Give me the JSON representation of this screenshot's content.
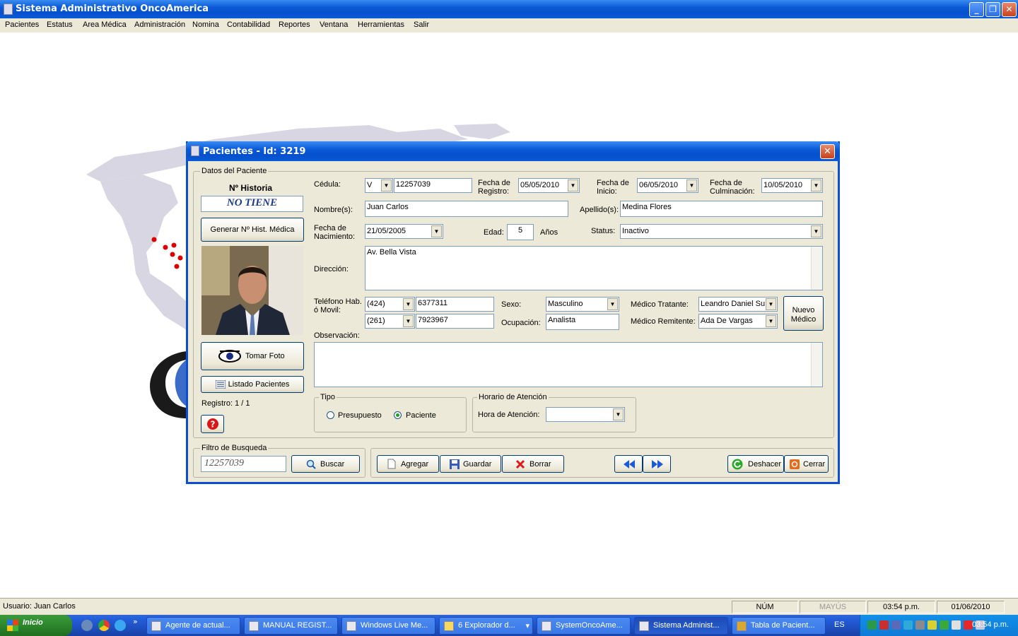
{
  "app": {
    "title": "Sistema Administrativo OncoAmerica"
  },
  "menu": [
    "Pacientes",
    "Estatus",
    "Area Médica",
    "Administración",
    "Nomina",
    "Contabilidad",
    "Reportes",
    "Ventana",
    "Herramientas",
    "Salir"
  ],
  "dialog": {
    "title": "Pacientes - Id: 3219",
    "group_datos": "Datos del Paciente",
    "historia_label": "Nº Historia",
    "historia_value": "NO TIENE",
    "gen_hist_button": "Generar Nº Hist. Médica",
    "tomar_foto_button": "Tomar Foto",
    "listado_button": "Listado Pacientes",
    "registro": "Registro:  1 / 1",
    "cedula_label": "Cédula:",
    "cedula_tipo": "V",
    "cedula_value": "12257039",
    "fecha_registro_label": "Fecha de Registro:",
    "fecha_registro": "05/05/2010",
    "fecha_inicio_label": "Fecha de Inicio:",
    "fecha_inicio": "06/05/2010",
    "fecha_culm_label": "Fecha de Culminación:",
    "fecha_culm": "10/05/2010",
    "nombres_label": "Nombre(s):",
    "nombres": "Juan Carlos",
    "apellidos_label": "Apellido(s):",
    "apellidos": "Medina Flores",
    "fecha_nac_label": "Fecha de Nacimiento:",
    "fecha_nac": "21/05/2005",
    "edad_label": "Edad:",
    "edad": "5",
    "anios_label": "Años",
    "status_label": "Status:",
    "status": "Inactivo",
    "direccion_label": "Dirección:",
    "direccion": "Av. Bella Vista",
    "telefono_label": "Teléfono Hab. ó Movil:",
    "tel1_code": "(424)",
    "tel1_num": "6377311",
    "tel2_code": "(261)",
    "tel2_num": "7923967",
    "sexo_label": "Sexo:",
    "sexo": "Masculino",
    "ocupacion_label": "Ocupación:",
    "ocupacion": "Analista",
    "medico_tratante_label": "Médico Tratante:",
    "medico_tratante": "Leandro Daniel Su",
    "medico_remitente_label": "Médico Remitente:",
    "medico_remitente": "Ada  De Vargas",
    "nuevo_medico_button": "Nuevo Médico",
    "observacion_label": "Observación:",
    "observacion": "",
    "tipo_label": "Tipo",
    "tipo_options": [
      "Presupuesto",
      "Paciente"
    ],
    "tipo_selected": "Paciente",
    "horario_label": "Horario de Atención",
    "hora_label": "Hora de Atención:",
    "hora_value": "",
    "filtro_label": "Filtro de Busqueda",
    "filtro_value": "12257039",
    "buscar_button": "Buscar",
    "agregar_button": "Agregar",
    "guardar_button": "Guardar",
    "borrar_button": "Borrar",
    "deshacer_button": "Deshacer",
    "cerrar_button": "Cerrar"
  },
  "status": {
    "usuario": "Usuario: Juan Carlos",
    "num": "NÚM",
    "mayus": "MAYÚS",
    "time": "03:54 p.m.",
    "date": "01/06/2010"
  },
  "taskbar": {
    "start": "Inicio",
    "buttons": [
      "Agente de actual...",
      "MANUAL REGIST...",
      "Windows Live Me...",
      "6 Explorador d...",
      "SystemOncoAme...",
      "Sistema Administ...",
      "Tabla de Pacient..."
    ],
    "active_index": 5,
    "lang": "ES",
    "clock": "03:54 p.m."
  },
  "colors": {
    "accent": "#0a5ad8",
    "taskbar": "#245edb",
    "start": "#2f8b2f",
    "map_dots": "#dd0000"
  }
}
